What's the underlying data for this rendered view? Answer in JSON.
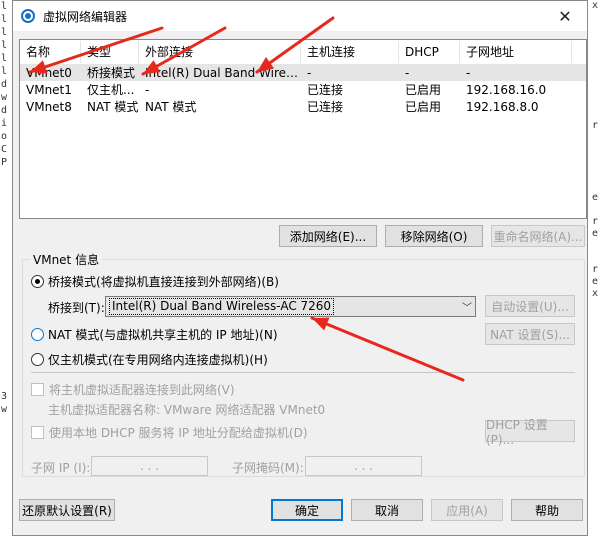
{
  "background": {
    "left_chars": [
      "l",
      "l",
      "l",
      "l",
      "l",
      "l",
      "d",
      "w",
      "d",
      "i",
      "o",
      "C",
      "P",
      "",
      "",
      "",
      "",
      "",
      "",
      "",
      "",
      "",
      "",
      "",
      "",
      "",
      "",
      "",
      "",
      "",
      "3",
      "w",
      "",
      ""
    ],
    "right_chars": [
      "x",
      "",
      "",
      "",
      "",
      "",
      "",
      "",
      "",
      "",
      "r",
      "",
      "",
      "",
      "",
      "",
      "e",
      "",
      "r",
      "e",
      "",
      "",
      "r",
      "e",
      "x"
    ]
  },
  "window": {
    "title": "虚拟网络编辑器",
    "close_glyph": "✕"
  },
  "table": {
    "headers": [
      "名称",
      "类型",
      "外部连接",
      "主机连接",
      "DHCP",
      "子网地址"
    ],
    "rows": [
      [
        "VMnet0",
        "桥接模式",
        "Intel(R) Dual Band Wireless-...",
        "-",
        "-",
        "-"
      ],
      [
        "VMnet1",
        "仅主机...",
        "-",
        "已连接",
        "已启用",
        "192.168.16.0"
      ],
      [
        "VMnet8",
        "NAT 模式",
        "NAT 模式",
        "已连接",
        "已启用",
        "192.168.8.0"
      ]
    ]
  },
  "list_buttons": {
    "add": "添加网络(E)...",
    "remove": "移除网络(O)",
    "rename": "重命名网络(A)..."
  },
  "vmnet_info": {
    "label": "VMnet 信息",
    "bridge_radio": "桥接模式(将虚拟机直接连接到外部网络)(B)",
    "bridge_to_label": "桥接到(T):",
    "bridge_to_value": "Intel(R) Dual Band Wireless-AC 7260",
    "auto_settings": "自动设置(U)...",
    "nat_radio": "NAT 模式(与虚拟机共享主机的 IP 地址)(N)",
    "nat_settings": "NAT 设置(S)...",
    "host_only_radio": "仅主机模式(在专用网络内连接虚拟机)(H)",
    "connect_adapter": "将主机虚拟适配器连接到此网络(V)",
    "adapter_name": "主机虚拟适配器名称: VMware 网络适配器 VMnet0",
    "use_dhcp": "使用本地 DHCP 服务将 IP 地址分配给虚拟机(D)",
    "dhcp_settings": "DHCP 设置(P)...",
    "subnet_ip_label": "子网 IP (I):",
    "subnet_mask_label": "子网掩码(M):",
    "ip_dots": ". . ."
  },
  "footer": {
    "restore": "还原默认设置(R)",
    "ok": "确定",
    "cancel": "取消",
    "apply": "应用(A)",
    "help": "帮助"
  },
  "colors": {
    "annotation_arrow": "#e8281e",
    "accent": "#0078d7"
  }
}
